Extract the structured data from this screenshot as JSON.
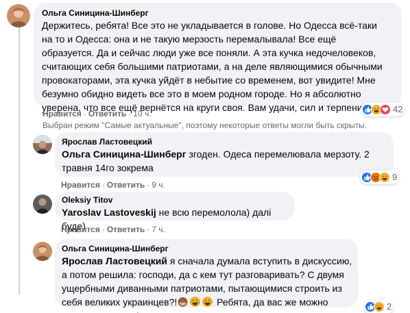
{
  "comments": [
    {
      "author": "Ольга Синицина-Шинберг",
      "text": "Держитесь, ребята! Все это не укладывается в голове. Но Одесса всё-таки на то и Одесса: она и не такую мерзость перемалывала! Все ещё образуется. Да и сейчас люди уже все поняли. А эта кучка недочеловеков, считающих себя большими патриотами, а на деле являющимися обычными провокаторами, эта кучка уйдёт в небытие со временем, вот увидите! Мне безумно обидно видеть все это в моем родном городе. Но я абсолютно уверена, что все ещё вернётся на круги своя. Вам удачи, сил и терпения",
      "like": "Нравится",
      "reply": "Ответить",
      "time": "10 ч.",
      "reaction_count": "42"
    }
  ],
  "notice": "Выбран режим \"Самые актуальные\", поэтому некоторые ответы могли быть скрыты.",
  "replies": [
    {
      "author": "Ярослав Ластовецкий",
      "mention": "Ольга Синицина-Шинберг",
      "text": " згоден. Одеса перемелювала мерзоту. 2 травня 14го зокрема",
      "like": "Нравится",
      "reply": "Ответить",
      "time": "9 ч.",
      "reaction_count": "9"
    },
    {
      "author": "Oleksiy Titov",
      "mention": "Yaroslav Lastoveskij",
      "text": " не всю перемолола) далі буде)",
      "like": "Нравится",
      "reply": "Ответить",
      "time": "7 ч."
    },
    {
      "author": "Ольга Синицина-Шинберг",
      "mention": "Ярослав Ластовецкий",
      "text": " я сначала думала вступить в дискуссию, а потом решила: господи, да с кем тут разговаривать? С двумя ущербными диванными патриотами, пытающимися строить из себя великих украинцев?!",
      "text_end": " Ребята, да вас же можно только пожалеть!...",
      "reaction_count": "2"
    }
  ],
  "colors": {
    "like_blue": "#1877f2",
    "love_red": "#f33e58",
    "haha_yellow": "#f7b125",
    "angry_orange": "#e9710f",
    "bubble_bg": "#f0f2f5",
    "meta_gray": "#65676b"
  },
  "icons": [
    "like-icon",
    "haha-icon",
    "love-icon",
    "angry-icon",
    "monkey-emoji",
    "laugh-emoji"
  ]
}
